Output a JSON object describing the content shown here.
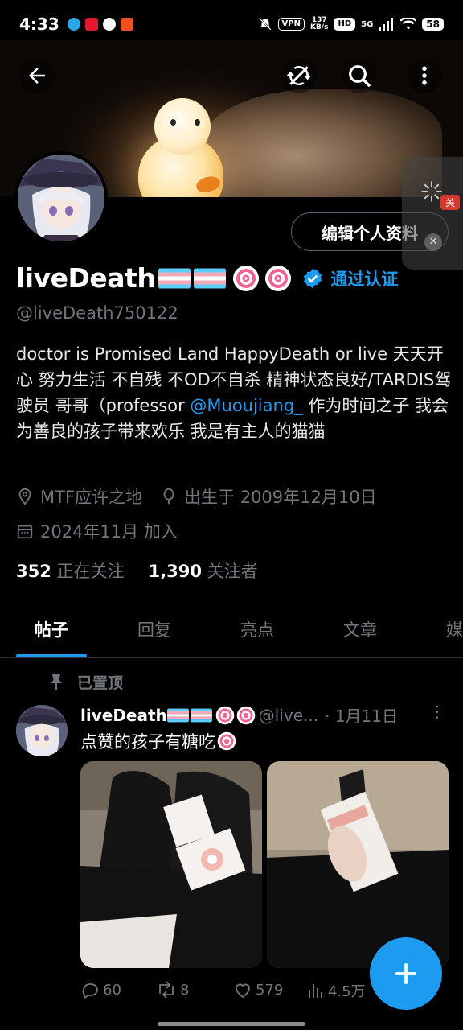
{
  "status_bar": {
    "time": "4:33",
    "vpn": "VPN",
    "net_speed_value": "137",
    "net_speed_unit": "KB/s",
    "hd": "HD",
    "network": "5G",
    "battery": "58"
  },
  "side_widget": {
    "tag": "关"
  },
  "profile": {
    "edit_button": "编辑个人资料",
    "display_name": "liveDeath",
    "verified_label": "通过认证",
    "handle": "@liveDeath750122",
    "bio_text": "doctor is Promised Land HappyDeath or live 天天开心 努力生活 不自残 不OD不自杀 精神状态良好/TARDIS驾驶员 哥哥（professor ",
    "bio_mention": "@Muoujiang_",
    "bio_tail": " 作为时间之子 我会为善良的孩子带来欢乐 我是有主人的猫猫",
    "location": "MTF应许之地",
    "birthday": "出生于 2009年12月10日",
    "joined": "2024年11月 加入",
    "following_count": "352",
    "following_label": "正在关注",
    "followers_count": "1,390",
    "followers_label": "关注者"
  },
  "tabs": [
    {
      "label": "帖子",
      "active": true
    },
    {
      "label": "回复",
      "active": false
    },
    {
      "label": "亮点",
      "active": false
    },
    {
      "label": "文章",
      "active": false
    },
    {
      "label": "媒",
      "active": false
    }
  ],
  "post": {
    "pinned_label": "已置顶",
    "author": "liveDeath",
    "handle": "@live...",
    "date": "· 1月11日",
    "text": "点赞的孩子有糖吃",
    "replies": "60",
    "reposts": "8",
    "likes": "579",
    "views": "4.5万"
  },
  "colors": {
    "accent": "#1d9bf0",
    "background": "#000000",
    "muted_text": "#71767b",
    "border": "#2f3336"
  },
  "icons": [
    "back-arrow-icon",
    "sync-off-icon",
    "search-icon",
    "more-vertical-icon",
    "verified-badge-icon",
    "location-icon",
    "birthday-icon",
    "calendar-icon",
    "pin-icon",
    "reply-icon",
    "repost-icon",
    "like-icon",
    "views-icon",
    "compose-plus-icon"
  ]
}
